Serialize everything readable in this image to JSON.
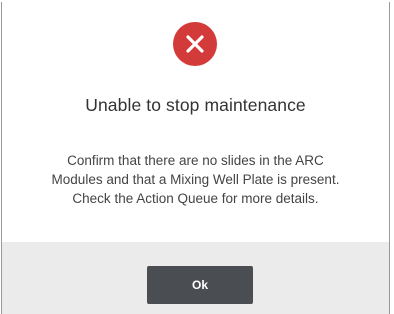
{
  "dialog": {
    "icon": "error-x-icon",
    "title": "Unable to stop maintenance",
    "message_lines": [
      "Confirm that there are no slides in the ARC",
      "Modules and that a Mixing Well Plate is present.",
      "Check the Action Queue for more details."
    ],
    "ok_label": "Ok"
  },
  "colors": {
    "error_red": "#d33a3a",
    "button_bg": "#4a4d52",
    "footer_bg": "#ebebeb"
  }
}
